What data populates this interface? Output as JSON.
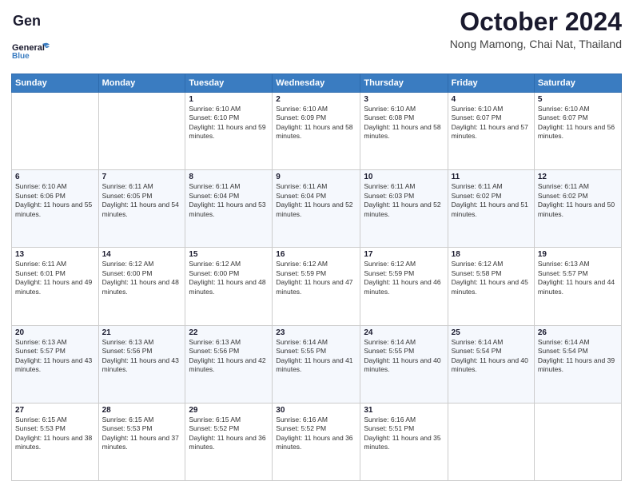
{
  "logo": {
    "line1": "General",
    "line2": "Blue"
  },
  "header": {
    "month_title": "October 2024",
    "location": "Nong Mamong, Chai Nat, Thailand"
  },
  "weekdays": [
    "Sunday",
    "Monday",
    "Tuesday",
    "Wednesday",
    "Thursday",
    "Friday",
    "Saturday"
  ],
  "weeks": [
    [
      {
        "day": "",
        "info": ""
      },
      {
        "day": "",
        "info": ""
      },
      {
        "day": "1",
        "info": "Sunrise: 6:10 AM\nSunset: 6:10 PM\nDaylight: 11 hours and 59 minutes."
      },
      {
        "day": "2",
        "info": "Sunrise: 6:10 AM\nSunset: 6:09 PM\nDaylight: 11 hours and 58 minutes."
      },
      {
        "day": "3",
        "info": "Sunrise: 6:10 AM\nSunset: 6:08 PM\nDaylight: 11 hours and 58 minutes."
      },
      {
        "day": "4",
        "info": "Sunrise: 6:10 AM\nSunset: 6:07 PM\nDaylight: 11 hours and 57 minutes."
      },
      {
        "day": "5",
        "info": "Sunrise: 6:10 AM\nSunset: 6:07 PM\nDaylight: 11 hours and 56 minutes."
      }
    ],
    [
      {
        "day": "6",
        "info": "Sunrise: 6:10 AM\nSunset: 6:06 PM\nDaylight: 11 hours and 55 minutes."
      },
      {
        "day": "7",
        "info": "Sunrise: 6:11 AM\nSunset: 6:05 PM\nDaylight: 11 hours and 54 minutes."
      },
      {
        "day": "8",
        "info": "Sunrise: 6:11 AM\nSunset: 6:04 PM\nDaylight: 11 hours and 53 minutes."
      },
      {
        "day": "9",
        "info": "Sunrise: 6:11 AM\nSunset: 6:04 PM\nDaylight: 11 hours and 52 minutes."
      },
      {
        "day": "10",
        "info": "Sunrise: 6:11 AM\nSunset: 6:03 PM\nDaylight: 11 hours and 52 minutes."
      },
      {
        "day": "11",
        "info": "Sunrise: 6:11 AM\nSunset: 6:02 PM\nDaylight: 11 hours and 51 minutes."
      },
      {
        "day": "12",
        "info": "Sunrise: 6:11 AM\nSunset: 6:02 PM\nDaylight: 11 hours and 50 minutes."
      }
    ],
    [
      {
        "day": "13",
        "info": "Sunrise: 6:11 AM\nSunset: 6:01 PM\nDaylight: 11 hours and 49 minutes."
      },
      {
        "day": "14",
        "info": "Sunrise: 6:12 AM\nSunset: 6:00 PM\nDaylight: 11 hours and 48 minutes."
      },
      {
        "day": "15",
        "info": "Sunrise: 6:12 AM\nSunset: 6:00 PM\nDaylight: 11 hours and 48 minutes."
      },
      {
        "day": "16",
        "info": "Sunrise: 6:12 AM\nSunset: 5:59 PM\nDaylight: 11 hours and 47 minutes."
      },
      {
        "day": "17",
        "info": "Sunrise: 6:12 AM\nSunset: 5:59 PM\nDaylight: 11 hours and 46 minutes."
      },
      {
        "day": "18",
        "info": "Sunrise: 6:12 AM\nSunset: 5:58 PM\nDaylight: 11 hours and 45 minutes."
      },
      {
        "day": "19",
        "info": "Sunrise: 6:13 AM\nSunset: 5:57 PM\nDaylight: 11 hours and 44 minutes."
      }
    ],
    [
      {
        "day": "20",
        "info": "Sunrise: 6:13 AM\nSunset: 5:57 PM\nDaylight: 11 hours and 43 minutes."
      },
      {
        "day": "21",
        "info": "Sunrise: 6:13 AM\nSunset: 5:56 PM\nDaylight: 11 hours and 43 minutes."
      },
      {
        "day": "22",
        "info": "Sunrise: 6:13 AM\nSunset: 5:56 PM\nDaylight: 11 hours and 42 minutes."
      },
      {
        "day": "23",
        "info": "Sunrise: 6:14 AM\nSunset: 5:55 PM\nDaylight: 11 hours and 41 minutes."
      },
      {
        "day": "24",
        "info": "Sunrise: 6:14 AM\nSunset: 5:55 PM\nDaylight: 11 hours and 40 minutes."
      },
      {
        "day": "25",
        "info": "Sunrise: 6:14 AM\nSunset: 5:54 PM\nDaylight: 11 hours and 40 minutes."
      },
      {
        "day": "26",
        "info": "Sunrise: 6:14 AM\nSunset: 5:54 PM\nDaylight: 11 hours and 39 minutes."
      }
    ],
    [
      {
        "day": "27",
        "info": "Sunrise: 6:15 AM\nSunset: 5:53 PM\nDaylight: 11 hours and 38 minutes."
      },
      {
        "day": "28",
        "info": "Sunrise: 6:15 AM\nSunset: 5:53 PM\nDaylight: 11 hours and 37 minutes."
      },
      {
        "day": "29",
        "info": "Sunrise: 6:15 AM\nSunset: 5:52 PM\nDaylight: 11 hours and 36 minutes."
      },
      {
        "day": "30",
        "info": "Sunrise: 6:16 AM\nSunset: 5:52 PM\nDaylight: 11 hours and 36 minutes."
      },
      {
        "day": "31",
        "info": "Sunrise: 6:16 AM\nSunset: 5:51 PM\nDaylight: 11 hours and 35 minutes."
      },
      {
        "day": "",
        "info": ""
      },
      {
        "day": "",
        "info": ""
      }
    ]
  ]
}
